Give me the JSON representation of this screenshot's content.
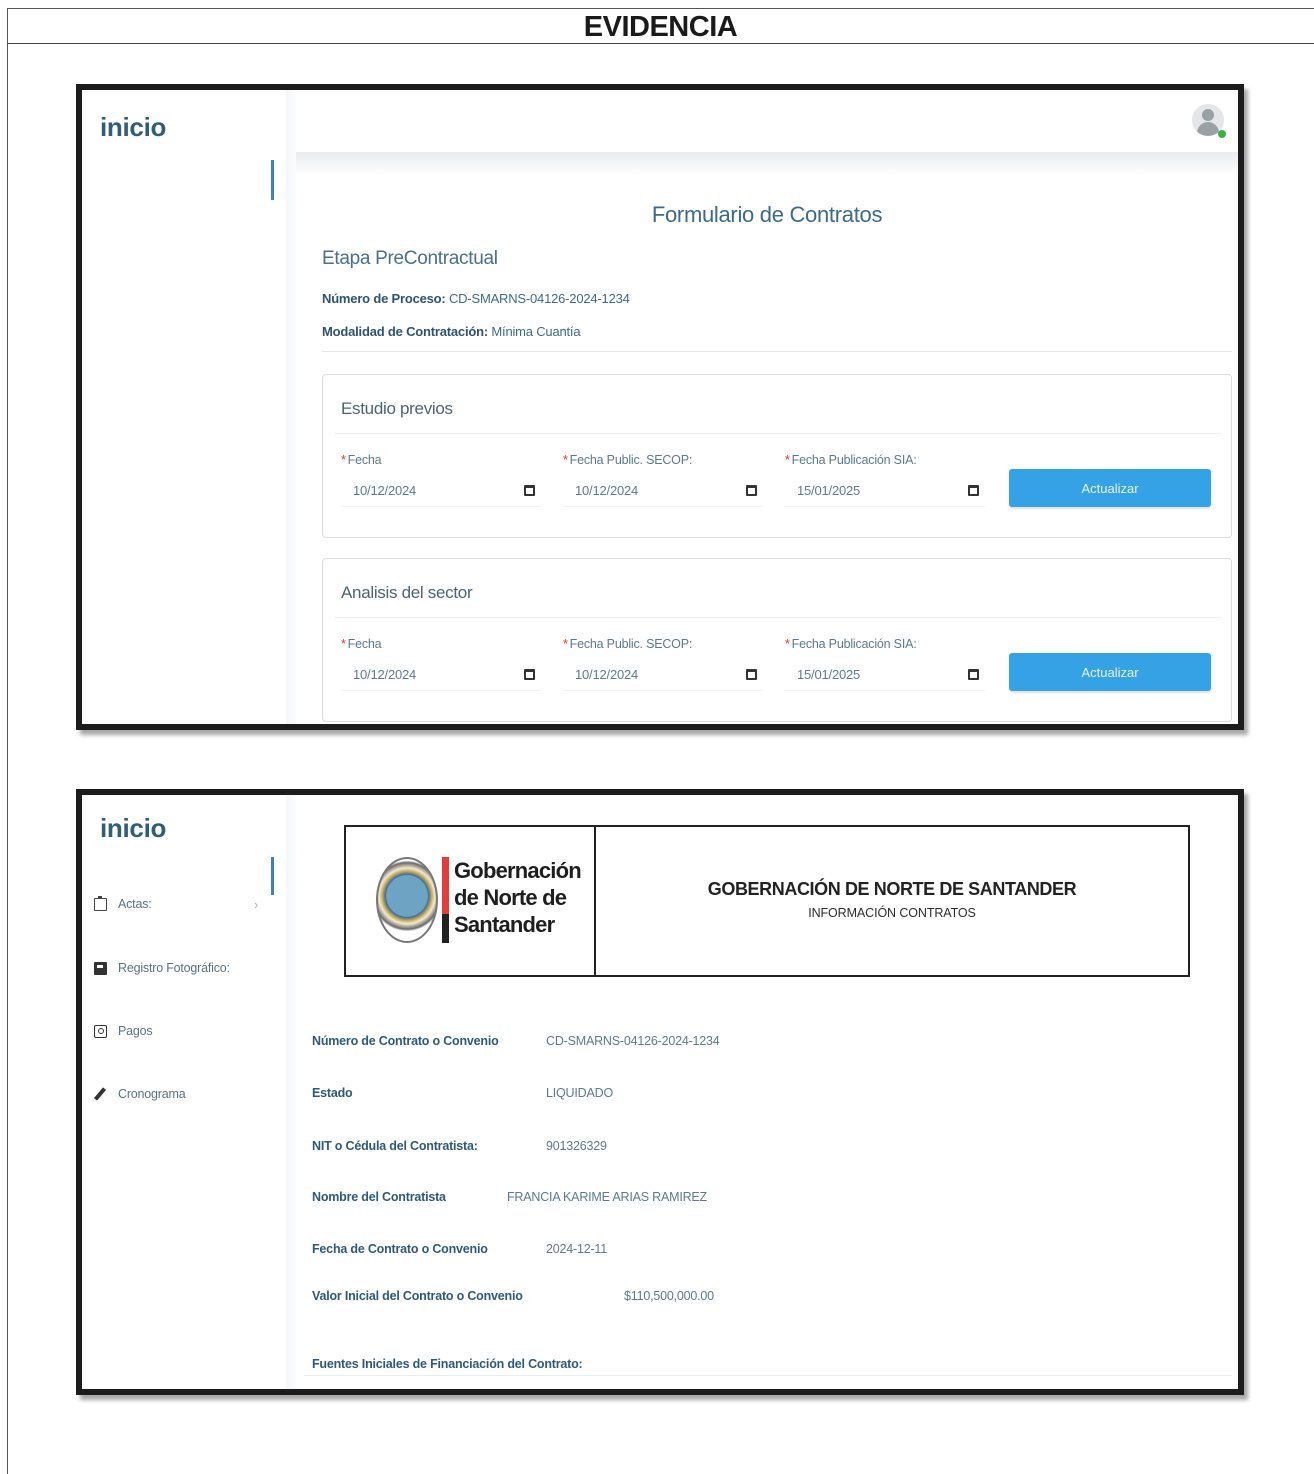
{
  "document": {
    "title": "EVIDENCIA"
  },
  "form_screen": {
    "sidebar": {
      "brand": "inicio"
    },
    "page_title": "Formulario de Contratos",
    "stage_title": "Etapa PreContractual",
    "process_number": {
      "label": "Número de Proceso:",
      "value": "CD-SMARNS-04126-2024-1234"
    },
    "contract_mode": {
      "label": "Modalidad de Contratación:",
      "value": "Mínima Cuantía"
    },
    "sections": [
      {
        "title": "Estudio previos",
        "fields": [
          {
            "label": "Fecha",
            "value": "10/12/2024"
          },
          {
            "label": "Fecha Public. SECOP:",
            "value": "10/12/2024"
          },
          {
            "label": "Fecha Publicación SIA:",
            "value": "15/01/2025"
          }
        ],
        "button": "Actualizar"
      },
      {
        "title": "Analisis del sector",
        "fields": [
          {
            "label": "Fecha",
            "value": "10/12/2024"
          },
          {
            "label": "Fecha Public. SECOP:",
            "value": "10/12/2024"
          },
          {
            "label": "Fecha Publicación SIA:",
            "value": "15/01/2025"
          }
        ],
        "button": "Actualizar"
      }
    ],
    "required_mark": "*",
    "accent_color": "#35a2e6"
  },
  "info_screen": {
    "sidebar": {
      "brand": "inicio",
      "items": [
        {
          "label": "Actas:",
          "icon": "clipboard-icon",
          "chevron": "›"
        },
        {
          "label": "Registro Fotográfico:",
          "icon": "photo-album-icon"
        },
        {
          "label": "Pagos",
          "icon": "camera-icon"
        },
        {
          "label": "Cronograma",
          "icon": "pencil-icon"
        }
      ]
    },
    "header": {
      "logo_text": [
        "Gobernación",
        "de Norte de",
        "Santander"
      ],
      "title": "GOBERNACIÓN DE NORTE DE SANTANDER",
      "subtitle": "INFORMACIÓN CONTRATOS"
    },
    "details": [
      {
        "label": "Número de Contrato o Convenio",
        "value": "CD-SMARNS-04126-2024-1234"
      },
      {
        "label": "Estado",
        "value": "LIQUIDADO"
      },
      {
        "label": "NIT o Cédula del Contratista:",
        "value": "901326329"
      },
      {
        "label": "Nombre del Contratista",
        "value": "FRANCIA KARIME ARIAS RAMIREZ"
      },
      {
        "label": "Fecha de Contrato o Convenio",
        "value": "2024-12-11"
      },
      {
        "label": "Valor Inicial del Contrato o Convenio",
        "value": "$110,500,000.00"
      },
      {
        "label": "Fuentes Iniciales de Financiación del Contrato:",
        "value": ""
      }
    ]
  }
}
